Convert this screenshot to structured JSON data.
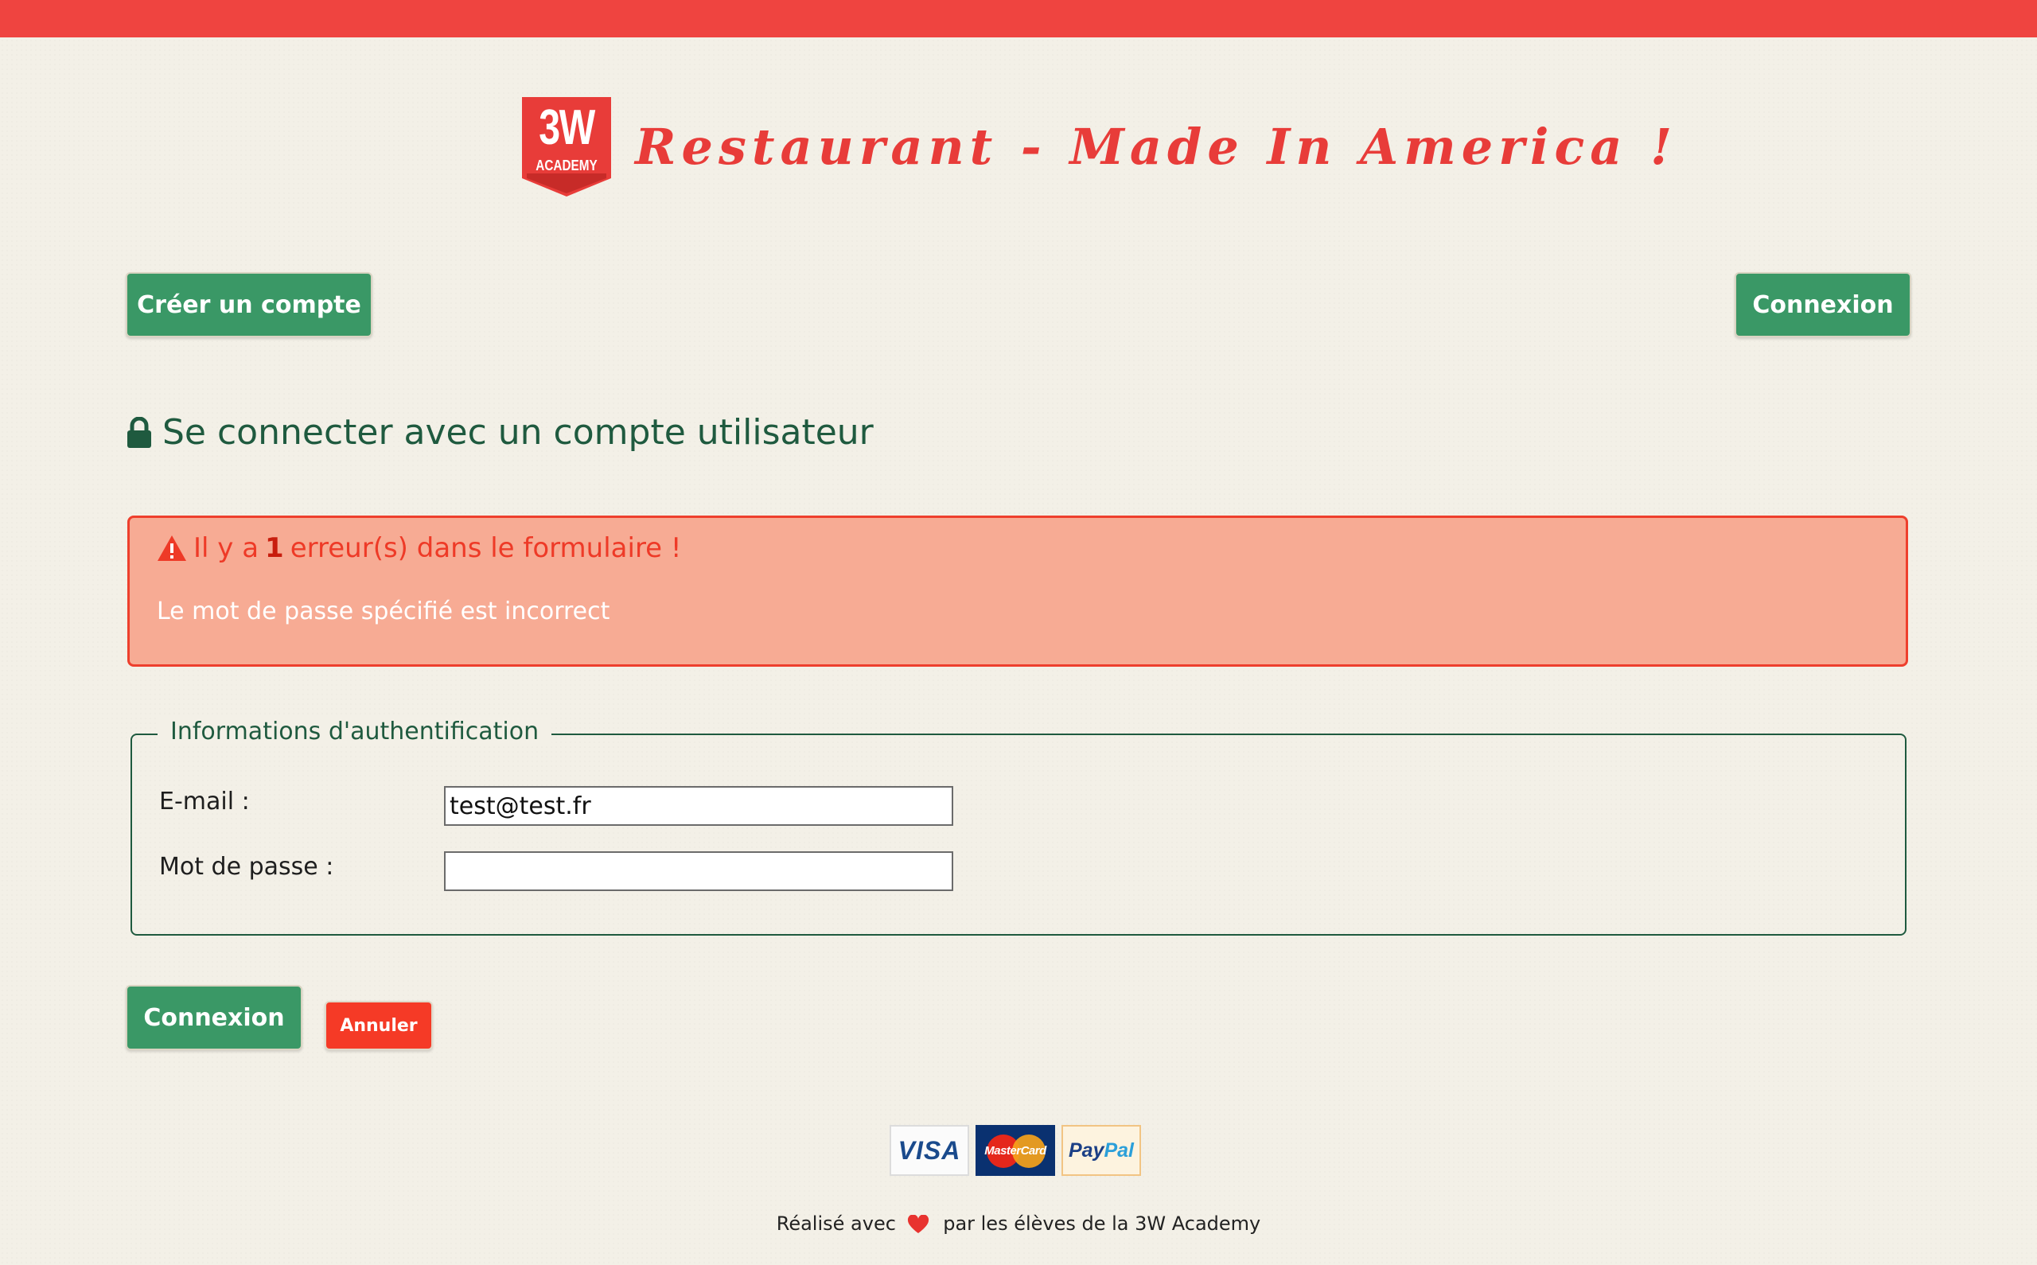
{
  "header": {
    "logo_line1": "3W",
    "logo_line2": "ACADEMY",
    "title": "Restaurant - Made In America !"
  },
  "nav": {
    "create_account_label": "Créer un compte",
    "login_label": "Connexion"
  },
  "page": {
    "heading": "Se connecter avec un compte utilisateur",
    "heading_icon": "lock-icon"
  },
  "alert": {
    "title_prefix": "Il y a",
    "error_count": "1",
    "title_suffix": "erreur(s) dans le formulaire !",
    "message": "Le mot de passe spécifié est incorrect",
    "icon": "warning-icon"
  },
  "form": {
    "legend": "Informations d'authentification",
    "email_label": "E-mail :",
    "email_value": "test@test.fr",
    "password_label": "Mot de passe :",
    "password_value": "",
    "submit_label": "Connexion",
    "cancel_label": "Annuler"
  },
  "payments": {
    "visa": "VISA",
    "mastercard": "MasterCard",
    "paypal_pay": "Pay",
    "paypal_pal": "Pal"
  },
  "footer": {
    "prefix": "Réalisé avec",
    "suffix": "par les élèves de la 3W Academy",
    "heart_icon": "heart-icon"
  },
  "colors": {
    "topbar": "#ef4440",
    "brand_red": "#e83c39",
    "green": "#3a9866",
    "dark_green": "#1f5a3f",
    "alert_bg": "#f7ab94",
    "alert_border": "#ee3f2d",
    "cancel_red": "#f53a26",
    "background": "#f3f0e7"
  }
}
